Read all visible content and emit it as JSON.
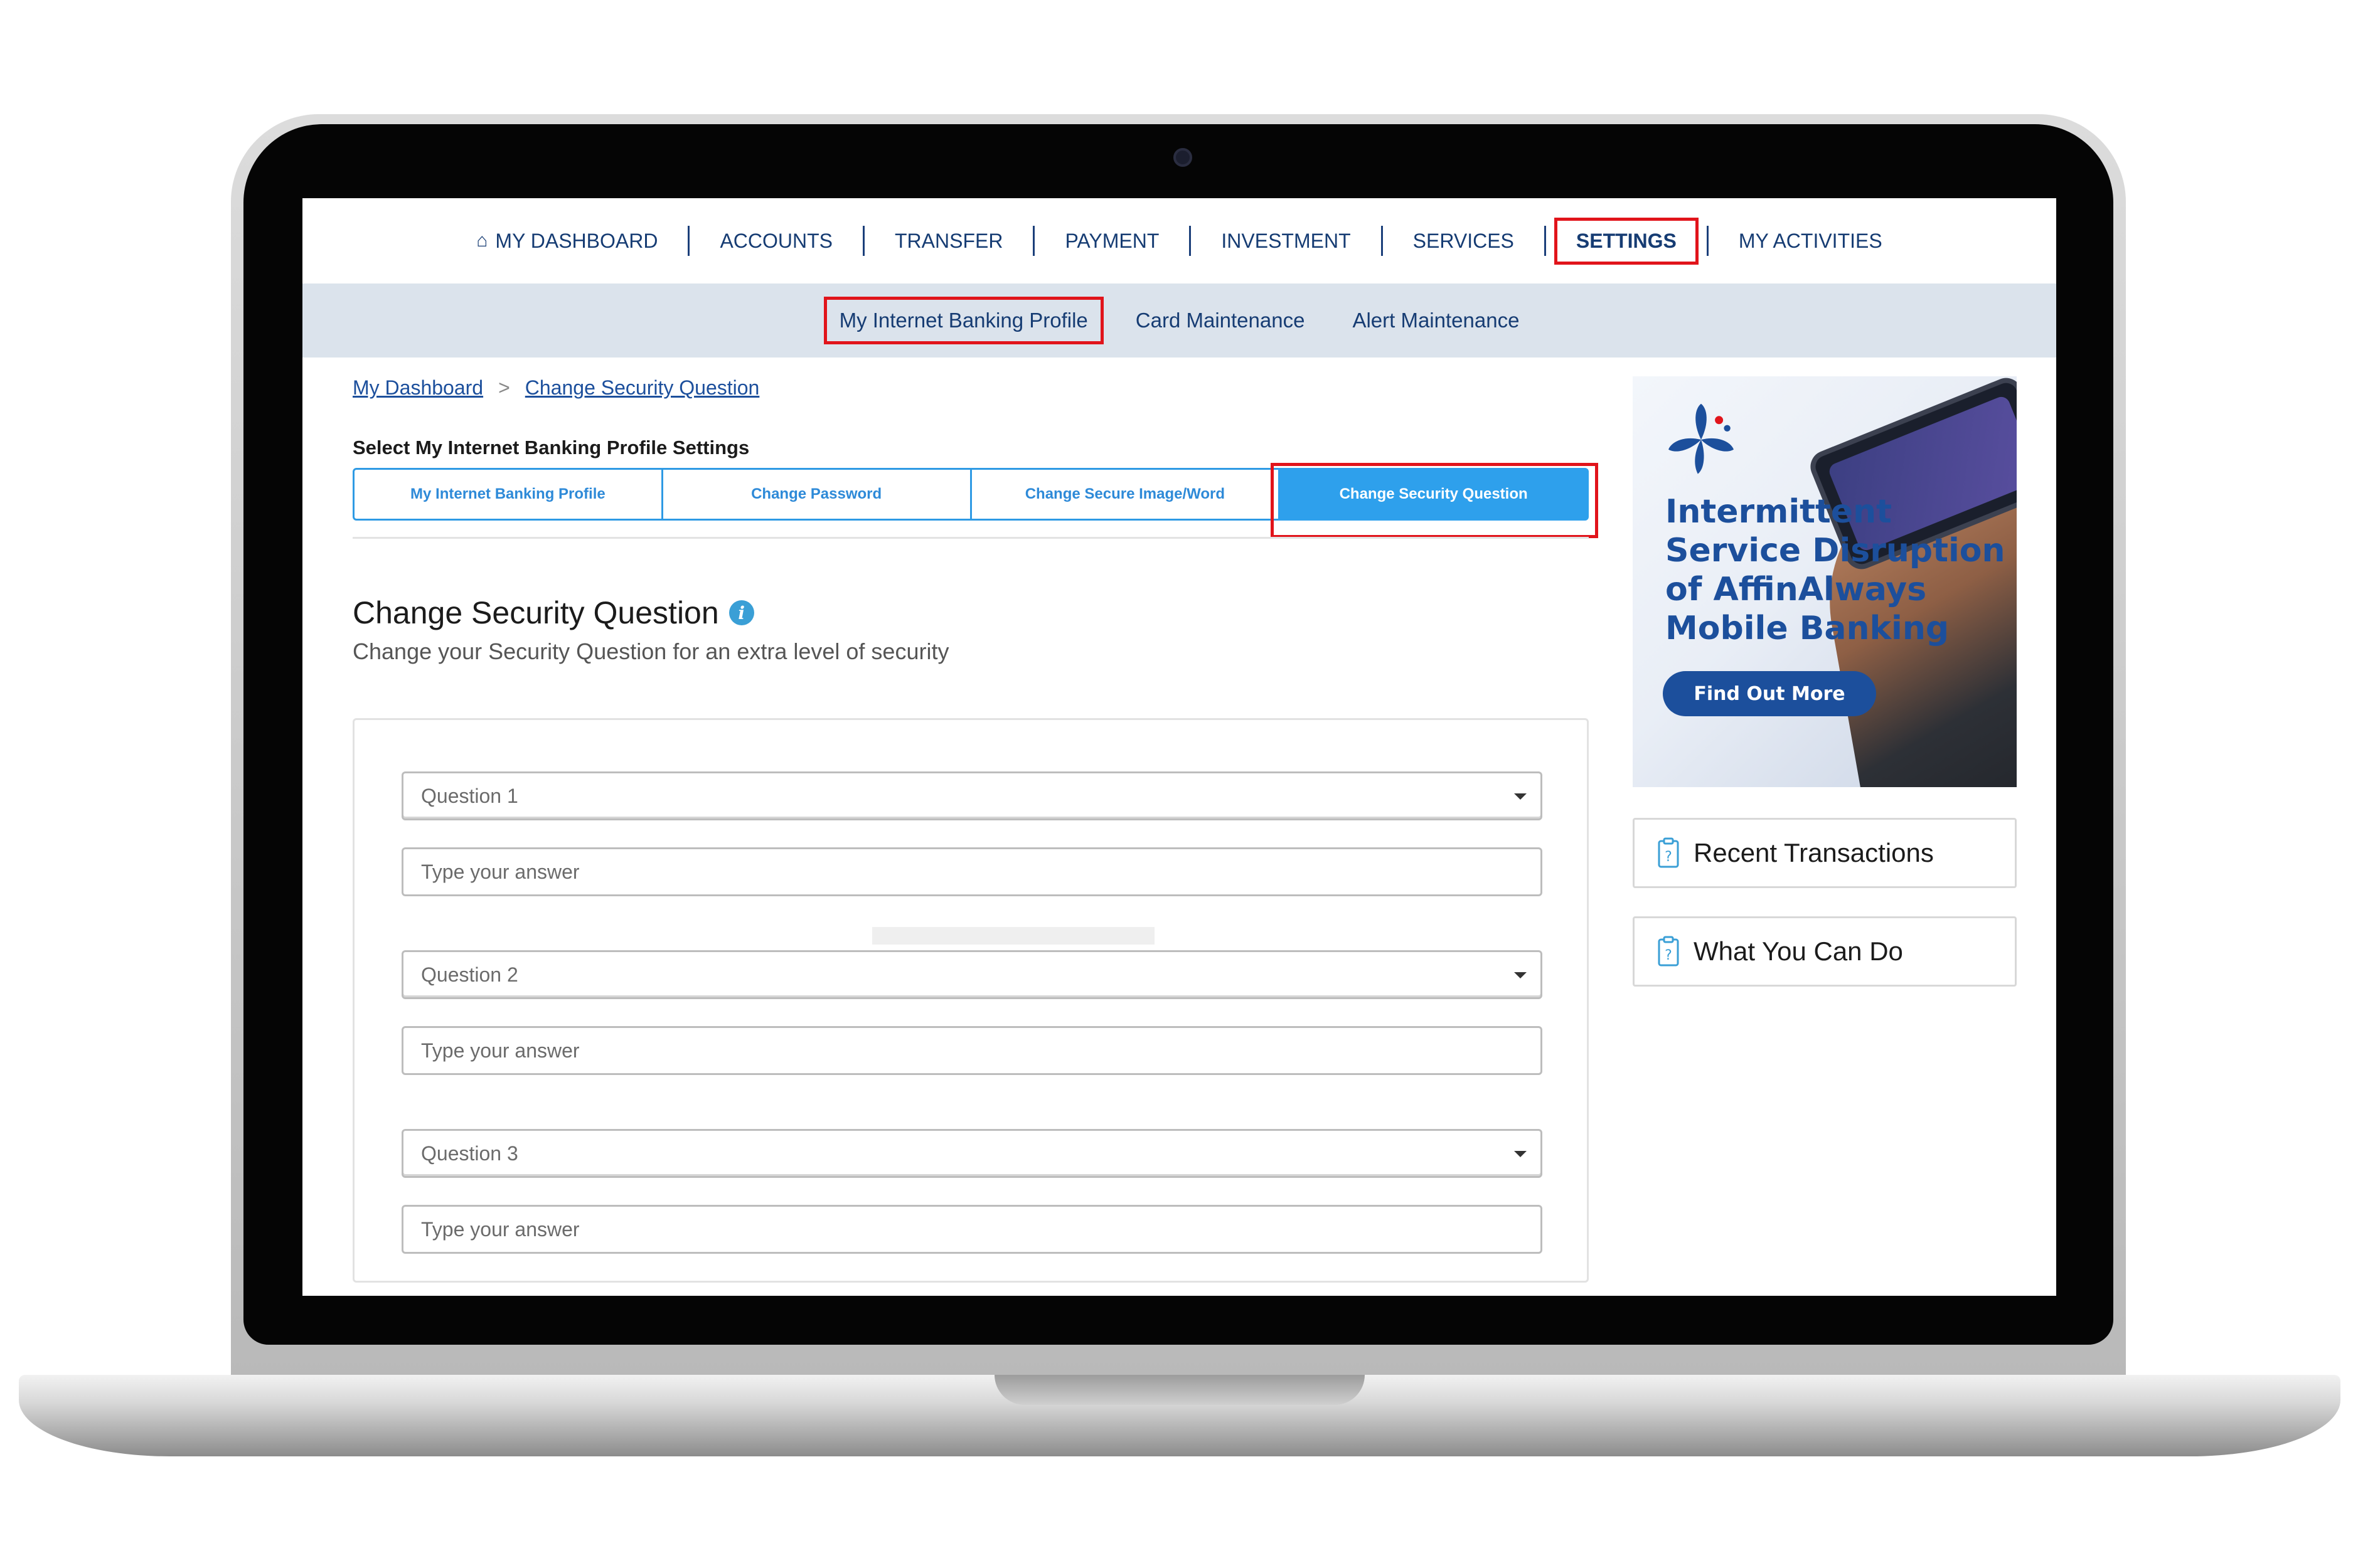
{
  "topnav": {
    "items": [
      {
        "label": "MY DASHBOARD"
      },
      {
        "label": "ACCOUNTS"
      },
      {
        "label": "TRANSFER"
      },
      {
        "label": "PAYMENT"
      },
      {
        "label": "INVESTMENT"
      },
      {
        "label": "SERVICES"
      },
      {
        "label": "SETTINGS"
      },
      {
        "label": "MY ACTIVITIES"
      }
    ],
    "active": "SETTINGS"
  },
  "subnav": {
    "items": [
      {
        "label": "My Internet Banking Profile"
      },
      {
        "label": "Card Maintenance"
      },
      {
        "label": "Alert Maintenance"
      }
    ]
  },
  "breadcrumb": {
    "home": "My Dashboard",
    "separator": ">",
    "current": "Change Security Question"
  },
  "profile": {
    "title": "Select My Internet Banking Profile Settings",
    "tabs": [
      {
        "label": "My Internet Banking Profile"
      },
      {
        "label": "Change Password"
      },
      {
        "label": "Change Secure Image/Word"
      },
      {
        "label": "Change Security Question"
      }
    ]
  },
  "section": {
    "title": "Change Security Question",
    "subtitle": "Change your Security Question for an extra level of security",
    "info_icon_glyph": "i"
  },
  "form": {
    "question1": "Question 1",
    "answer1_placeholder": "Type your answer",
    "question2": "Question 2",
    "answer2_placeholder": "Type your answer",
    "question3": "Question 3",
    "answer3_placeholder": "Type your answer"
  },
  "ad": {
    "line1": "Intermittent",
    "line2": "Service Disruption",
    "line3": "of AffinAlways",
    "line4": "Mobile Banking",
    "button": "Find Out More"
  },
  "sidebar": {
    "recent": "Recent Transactions",
    "what_you_can_do": "What You Can Do"
  },
  "colors": {
    "brand_blue": "#1c4f9c",
    "tab_active": "#2ea0ec",
    "highlight_red": "#e1141b",
    "subnav_bg": "#dbe3ec"
  },
  "icons": [
    "home-icon",
    "info-icon",
    "dropdown-caret-icon",
    "clipboard-question-icon",
    "affin-logo-icon"
  ]
}
